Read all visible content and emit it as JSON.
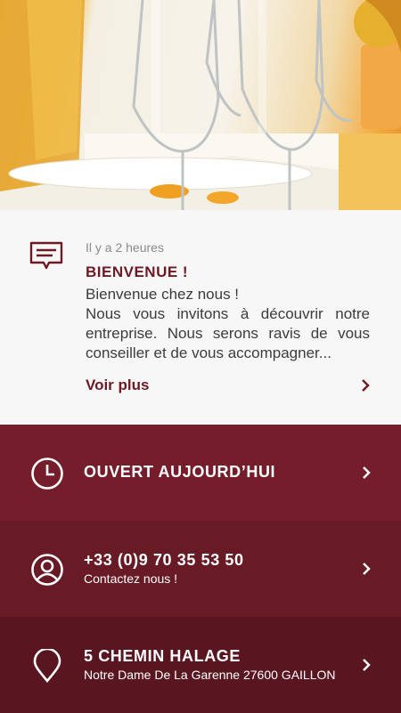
{
  "notice": {
    "time": "Il y a 2 heures",
    "title": "BIENVENUE !",
    "body_line1": "Bienvenue chez nous !",
    "body_line2": "Nous vous invitons à découvrir notre entreprise. Nous serons ravis de vous conseiller et de vous accompagner...",
    "more": "Voir plus"
  },
  "hours": {
    "label": "OUVERT AUJOURD’HUI"
  },
  "phone": {
    "number": "+33 (0)9 70 35 53 50",
    "sub": "Contactez nous !"
  },
  "address": {
    "street": "5 CHEMIN HALAGE",
    "city": "Notre Dame De La Garenne 27600 GAILLON"
  },
  "colors": {
    "row1": "#761d2b",
    "row2": "#681a25",
    "row3": "#5a1620",
    "accent": "#6e1a24"
  }
}
